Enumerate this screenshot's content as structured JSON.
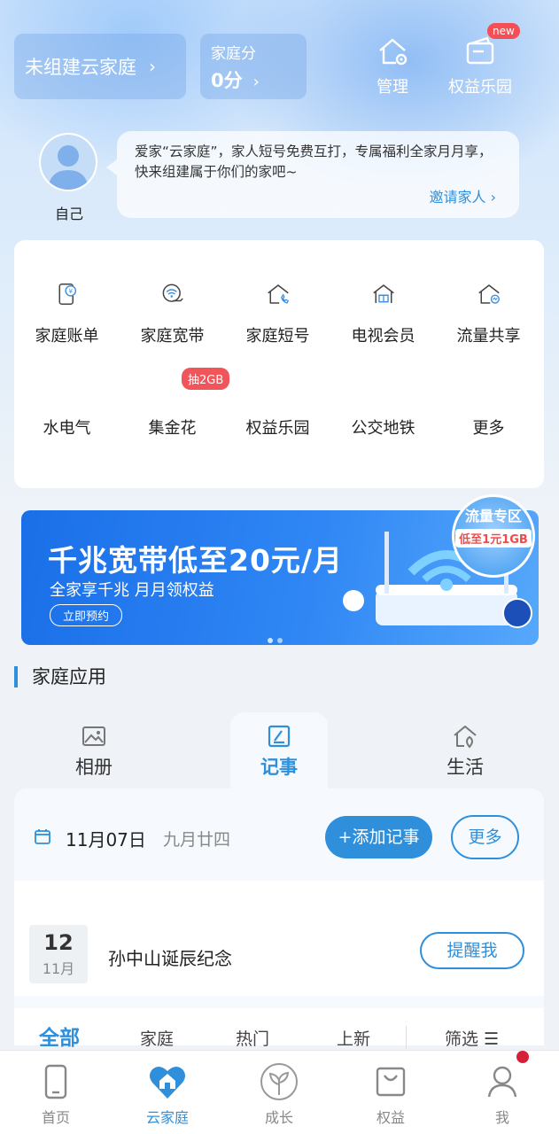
{
  "header": {
    "home_card": {
      "label": "未组建云家庭",
      "chevron": "›"
    },
    "score_card": {
      "label": "家庭分",
      "value": "0分",
      "chevron": "›"
    },
    "actions": [
      {
        "label": "管理",
        "icon": "home-gear-icon"
      },
      {
        "label": "权益乐园",
        "icon": "wallet-icon",
        "badge": "new"
      }
    ]
  },
  "profile": {
    "name": "自己",
    "message": "爱家“云家庭”，家人短号免费互打，专属福利全家月月享，快来组建属于你们的家吧~",
    "invite_label": "邀请家人 ›"
  },
  "services": {
    "row1": [
      {
        "label": "家庭账单",
        "icon": "bill-phone-icon"
      },
      {
        "label": "家庭宽带",
        "icon": "wifi-hand-icon"
      },
      {
        "label": "家庭短号",
        "icon": "house-phone-icon"
      },
      {
        "label": "电视会员",
        "icon": "house-gift-icon"
      },
      {
        "label": "流量共享",
        "icon": "house-share-icon"
      }
    ],
    "row2": [
      {
        "label": "水电气",
        "icon": "utilities-icon"
      },
      {
        "label": "集金花",
        "icon": "flower-icon",
        "tag": "抽2GB"
      },
      {
        "label": "权益乐园",
        "icon": "house-crown-icon"
      },
      {
        "label": "公交地铁",
        "icon": "transit-qr-icon"
      },
      {
        "label": "更多",
        "icon": "grid-more-icon"
      }
    ]
  },
  "banner": {
    "title": "千兆宽带低至20元/月",
    "subtitle": "全家享千兆 月月领权益",
    "button": "立即预约",
    "zone_title": "流量专区",
    "zone_tag": "低至1元1GB"
  },
  "family_apps": {
    "section_title": "家庭应用",
    "tabs": [
      {
        "label": "相册",
        "icon": "photo-icon"
      },
      {
        "label": "记事",
        "icon": "notebook-icon",
        "active": true
      },
      {
        "label": "生活",
        "icon": "house-leaf-icon"
      }
    ],
    "notes": {
      "date": "11月07日",
      "lunar": "九月廿四",
      "add_button": "+添加记事",
      "more_button": "更多",
      "event": {
        "day": "12",
        "month": "11月",
        "title": "孙中山诞辰纪念",
        "remind_button": "提醒我"
      },
      "filters": [
        "全部",
        "家庭",
        "热门",
        "上新",
        "筛选 ☰"
      ]
    }
  },
  "bottom_nav": [
    {
      "label": "首页",
      "icon": "phone-icon"
    },
    {
      "label": "云家庭",
      "icon": "heart-home-icon",
      "active": true
    },
    {
      "label": "成长",
      "icon": "sprout-icon"
    },
    {
      "label": "权益",
      "icon": "bag-icon"
    },
    {
      "label": "我",
      "icon": "user-icon"
    }
  ],
  "colors": {
    "accent": "#2f8fdb",
    "badge": "#f44f55",
    "banner": "#2f86f4"
  }
}
